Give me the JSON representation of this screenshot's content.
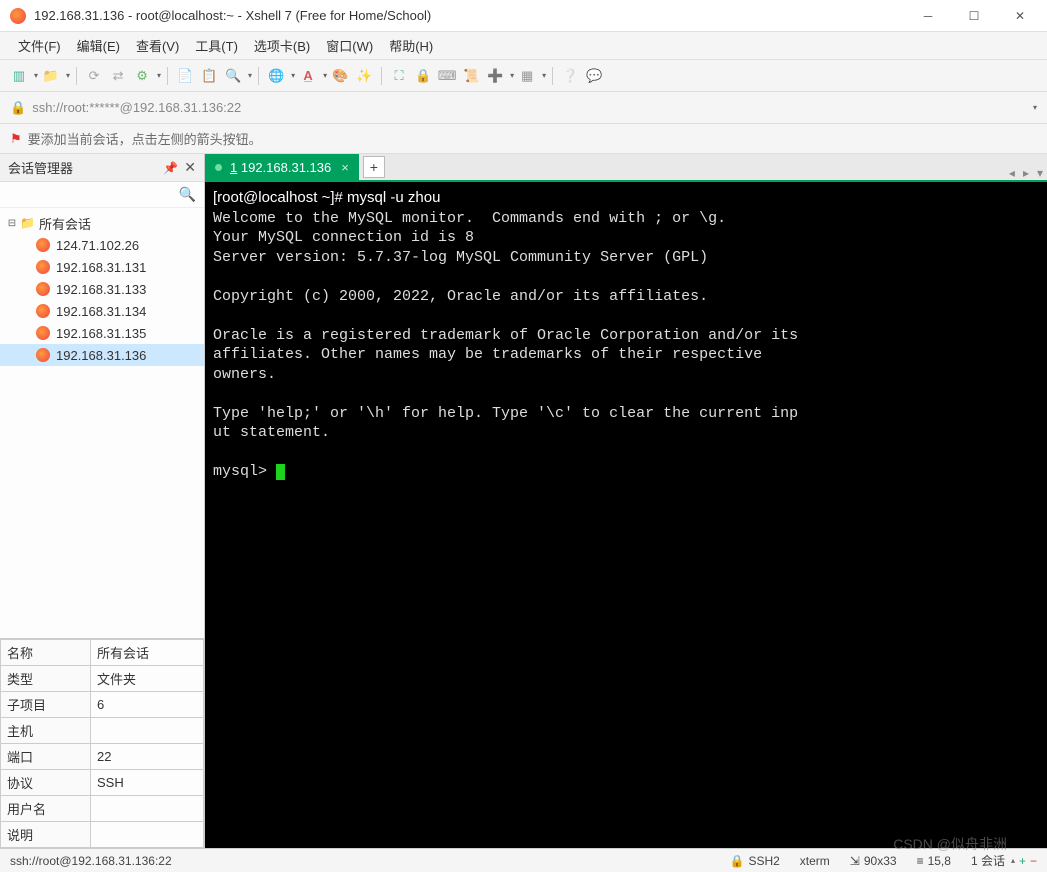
{
  "window": {
    "title": "192.168.31.136 - root@localhost:~ - Xshell 7 (Free for Home/School)"
  },
  "menubar": [
    "文件(F)",
    "编辑(E)",
    "查看(V)",
    "工具(T)",
    "选项卡(B)",
    "窗口(W)",
    "帮助(H)"
  ],
  "addressbar": {
    "url": "ssh://root:******@192.168.31.136:22"
  },
  "hintbar": {
    "text": "要添加当前会话，点击左侧的箭头按钮。"
  },
  "sidepanel": {
    "title": "会话管理器",
    "root": "所有会话",
    "sessions": [
      "124.71.102.26",
      "192.168.31.131",
      "192.168.31.133",
      "192.168.31.134",
      "192.168.31.135",
      "192.168.31.136"
    ],
    "selected_index": 5
  },
  "properties": {
    "rows": [
      {
        "k": "名称",
        "v": "所有会话"
      },
      {
        "k": "类型",
        "v": "文件夹"
      },
      {
        "k": "子项目",
        "v": "6"
      },
      {
        "k": "主机",
        "v": ""
      },
      {
        "k": "端口",
        "v": "22"
      },
      {
        "k": "协议",
        "v": "SSH"
      },
      {
        "k": "用户名",
        "v": ""
      },
      {
        "k": "说明",
        "v": ""
      }
    ]
  },
  "tab": {
    "index": "1",
    "label": "192.168.31.136"
  },
  "terminal": {
    "prompt_line": "[root@localhost ~]# mysql -u zhou",
    "body_lines": [
      "Welcome to the MySQL monitor.  Commands end with ; or \\g.",
      "Your MySQL connection id is 8",
      "Server version: 5.7.37-log MySQL Community Server (GPL)",
      "",
      "Copyright (c) 2000, 2022, Oracle and/or its affiliates.",
      "",
      "Oracle is a registered trademark of Oracle Corporation and/or its",
      "affiliates. Other names may be trademarks of their respective",
      "owners.",
      "",
      "Type 'help;' or '\\h' for help. Type '\\c' to clear the current inp",
      "ut statement.",
      ""
    ],
    "mysql_prompt": "mysql> "
  },
  "statusbar": {
    "left": "ssh://root@192.168.31.136:22",
    "ssh": "SSH2",
    "term": "xterm",
    "size": "90x33",
    "pos": "15,8",
    "sess": "1 会话"
  },
  "watermark": "CSDN @似舟非洲"
}
